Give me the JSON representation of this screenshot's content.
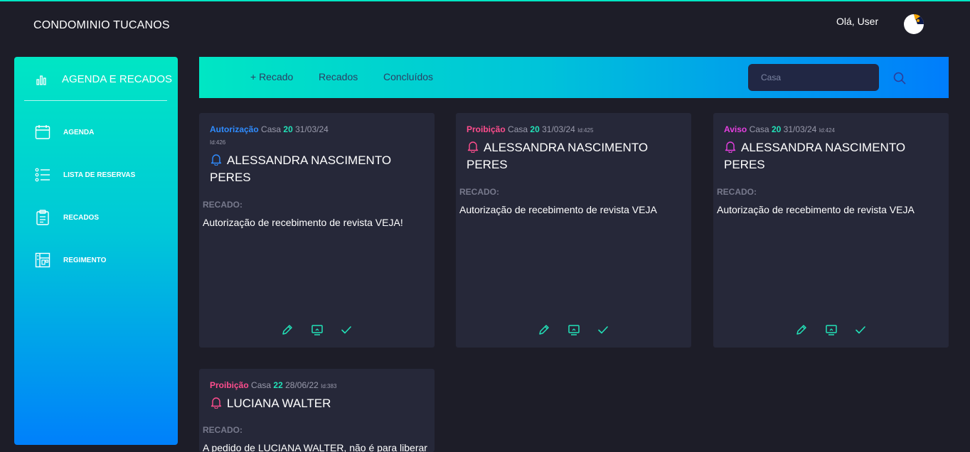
{
  "app": {
    "brand": "CONDOMINIO TUCANOS",
    "greeting": "Olá, User"
  },
  "sidebar": {
    "title": "AGENDA E RECADOS",
    "items": [
      {
        "label": "AGENDA",
        "icon": "calendar-icon"
      },
      {
        "label": "LISTA DE RESERVAS",
        "icon": "list-icon"
      },
      {
        "label": "RECADOS",
        "icon": "clipboard-icon"
      },
      {
        "label": "REGIMENTO",
        "icon": "layout-icon"
      }
    ]
  },
  "toolbar": {
    "tabs": [
      "+ Recado",
      "Recados",
      "Concluídos"
    ],
    "search_placeholder": "Casa"
  },
  "colors": {
    "autorizacao": "#2f8cff",
    "proibicao": "#ff4d8d",
    "aviso": "#e63fe0",
    "accent": "#22e2b8"
  },
  "cards": [
    {
      "type": "Autorização",
      "casa_label": "Casa",
      "casa": "20",
      "date": "31/03/24",
      "id": "Id:426",
      "name": "ALESSANDRA NASCIMENTO PERES",
      "recado_label": "RECADO:",
      "recado": "Autorização de recebimento de revista VEJA!"
    },
    {
      "type": "Proibição",
      "casa_label": "Casa",
      "casa": "20",
      "date": "31/03/24",
      "id": "Id:425",
      "name": "ALESSANDRA NASCIMENTO PERES",
      "recado_label": "RECADO:",
      "recado": "Autorização de recebimento de revista VEJA"
    },
    {
      "type": "Aviso",
      "casa_label": "Casa",
      "casa": "20",
      "date": "31/03/24",
      "id": "Id:424",
      "name": "ALESSANDRA NASCIMENTO PERES",
      "recado_label": "RECADO:",
      "recado": "Autorização de recebimento de revista VEJA"
    },
    {
      "type": "Proibição",
      "casa_label": "Casa",
      "casa": "22",
      "date": "28/06/22",
      "id": "Id:383",
      "name": "LUCIANA WALTER",
      "recado_label": "RECADO:",
      "recado": "A pedido de LUCIANA WALTER, não é para liberar"
    }
  ]
}
